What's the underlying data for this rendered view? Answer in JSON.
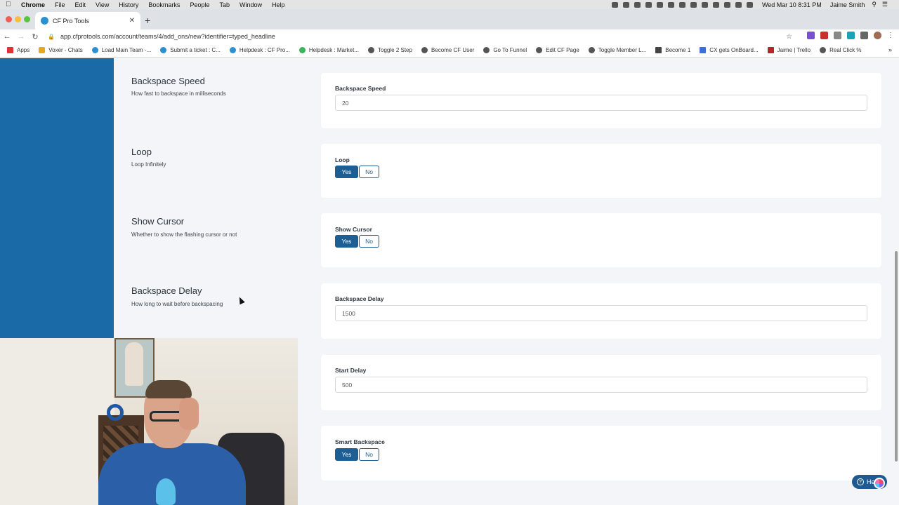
{
  "menubar": {
    "app": "Chrome",
    "items": [
      "File",
      "Edit",
      "View",
      "History",
      "Bookmarks",
      "People",
      "Tab",
      "Window",
      "Help"
    ],
    "clock": "Wed Mar 10  8:31 PM",
    "user": "Jaime Smith"
  },
  "browser": {
    "tab_title": "CF Pro Tools",
    "url": "app.cfprotools.com/account/teams/4/add_ons/new?identifier=typed_headline",
    "bookmarks": [
      "Apps",
      "Voxer - Chats",
      "Load Main Team -...",
      "Submit a ticket : C...",
      "Helpdesk : CF Pro...",
      "Helpdesk : Market...",
      "Toggle 2 Step",
      "Become CF User",
      "Go To Funnel",
      "Edit CF Page",
      "Toggle Member L...",
      "Become 1",
      "CX gets OnBoard...",
      "Jaime | Trello",
      "Real Click %"
    ]
  },
  "settings": {
    "backspace_speed": {
      "title": "Backspace Speed",
      "desc": "How fast to backspace in milliseconds",
      "label": "Backspace Speed",
      "value": "20"
    },
    "loop": {
      "title": "Loop",
      "desc": "Loop Infinitely",
      "label": "Loop",
      "yes": "Yes",
      "no": "No",
      "selected": "Yes"
    },
    "show_cursor": {
      "title": "Show Cursor",
      "desc": "Whether to show the flashing cursor or not",
      "label": "Show Cursor",
      "yes": "Yes",
      "no": "No",
      "selected": "Yes"
    },
    "backspace_delay": {
      "title": "Backspace Delay",
      "desc": "How long to wait before backspacing",
      "label": "Backspace Delay",
      "value": "1500"
    },
    "start_delay": {
      "label": "Start Delay",
      "value": "500"
    },
    "smart_backspace": {
      "label": "Smart Backspace",
      "yes": "Yes",
      "no": "No",
      "selected": "Yes"
    }
  },
  "help_widget": {
    "label": "Help"
  },
  "colors": {
    "sidebar": "#1a6aa8",
    "toggle_active": "#1d5f94",
    "page_bg": "#f3f5f8"
  }
}
